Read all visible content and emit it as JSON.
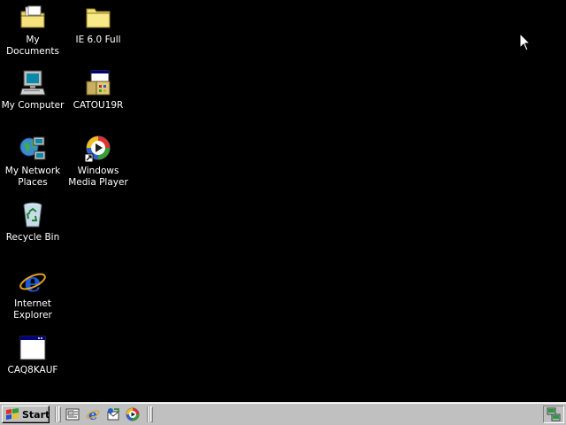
{
  "desktop": {
    "icons": [
      {
        "label": "My Documents",
        "icon": "my-documents-folder-icon"
      },
      {
        "label": "IE 6.0 Full",
        "icon": "folder-icon"
      },
      {
        "label": "My Computer",
        "icon": "my-computer-icon"
      },
      {
        "label": "CATOU19R",
        "icon": "setup-program-icon"
      },
      {
        "label": "My Network Places",
        "icon": "network-places-icon"
      },
      {
        "label": "Windows Media Player",
        "icon": "media-player-icon"
      },
      {
        "label": "Recycle Bin",
        "icon": "recycle-bin-icon"
      },
      {
        "label": "Internet Explorer",
        "icon": "internet-explorer-icon"
      },
      {
        "label": "CAQ8KAUF",
        "icon": "application-window-icon"
      }
    ],
    "background_color": "#000000"
  },
  "taskbar": {
    "start_label": "Start",
    "quick_launch": [
      {
        "icon": "show-desktop-icon"
      },
      {
        "icon": "internet-explorer-icon"
      },
      {
        "icon": "outlook-express-icon"
      },
      {
        "icon": "media-player-icon"
      }
    ],
    "tray": [
      {
        "icon": "network-tray-icon"
      }
    ],
    "color": "#c0c0c0"
  }
}
